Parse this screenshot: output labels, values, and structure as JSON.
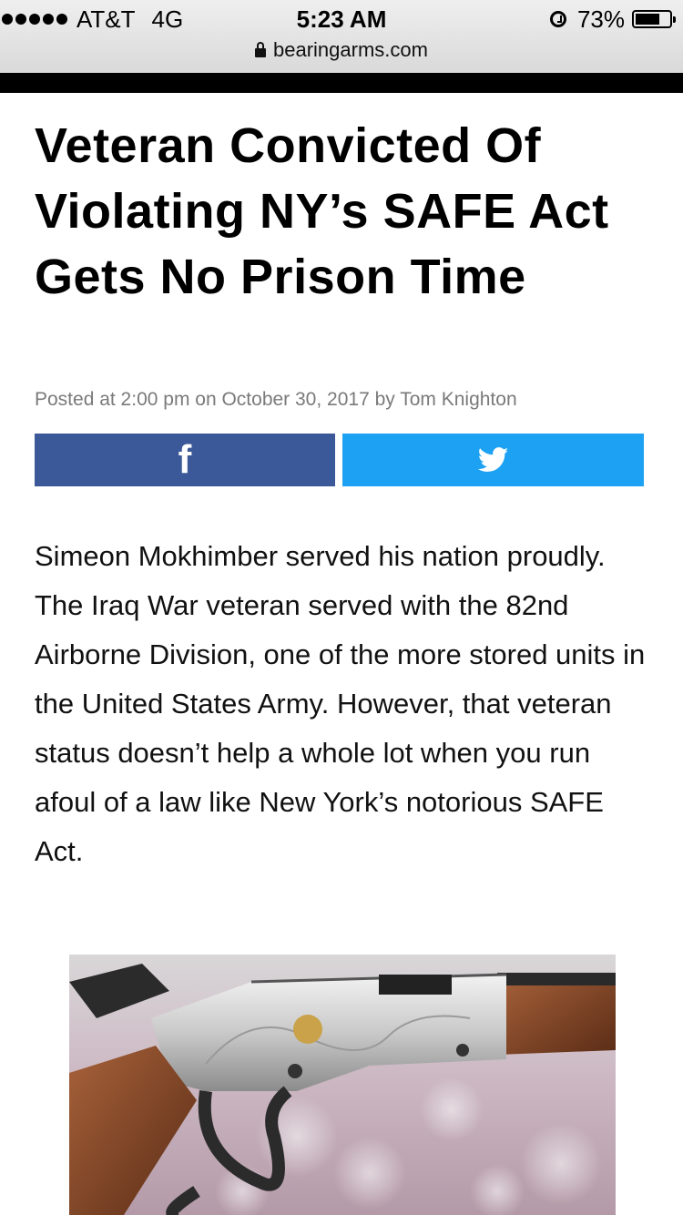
{
  "status_bar": {
    "carrier": "AT&T",
    "network": "4G",
    "time": "5:23 AM",
    "battery_percent_label": "73%",
    "battery_level": 0.73,
    "signal_dots": 5
  },
  "browser": {
    "url": "bearingarms.com"
  },
  "article": {
    "headline": "Veteran Convicted Of Violating NY’s SAFE Act Gets No Prison Time",
    "byline": "Posted at 2:00 pm on October 30, 2017 by Tom Knighton",
    "body": "Simeon Mokhimber served his nation proudly. The Iraq War veteran served with the 82nd Airborne Division, one of the more stored units in the United States Army. However, that veteran status doesn’t help a whole lot when you run afoul of a law like New York’s notorious SAFE Act."
  },
  "share": {
    "facebook_icon": "facebook-icon",
    "twitter_icon": "twitter-icon",
    "facebook_color": "#3b5998",
    "twitter_color": "#1da1f2"
  }
}
